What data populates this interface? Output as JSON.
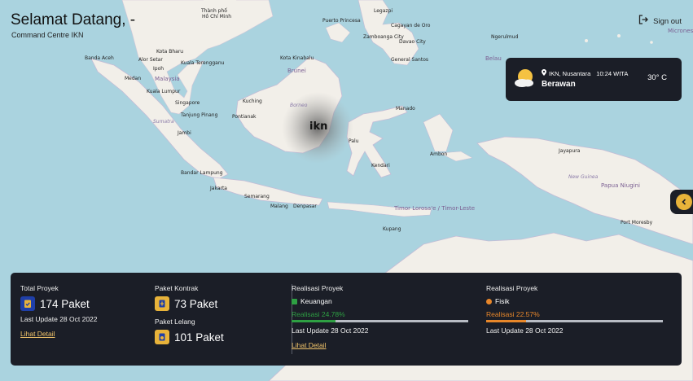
{
  "header": {
    "greeting": "Selamat Datang, -",
    "subtitle": "Command Centre IKN",
    "signout_label": "Sign out"
  },
  "weather": {
    "location": "IKN, Nusantara",
    "time": "10:24 WITA",
    "condition": "Berawan",
    "temperature": "30° C"
  },
  "map": {
    "marker_label": "ikn",
    "labels": {
      "thanh_phoho": "Thành phố",
      "hochiminh": "Hồ Chí Minh",
      "puerto": "Puerto Princesa",
      "legazpi": "Legazpi",
      "cagayan": "Cagayan de Oro",
      "zamboanga": "Zamboanga City",
      "davao": "Davao City",
      "ngerulmud": "Ngerulmud",
      "micronesia": "Micronesi",
      "banda_aceh": "Banda Aceh",
      "alor_setar": "Alor Setar",
      "kota_bharu": "Kota Bharu",
      "kuala_terengganu": "Kuala Terengganu",
      "kota_kinabalu": "Kota Kinabalu",
      "general_santos": "General Santos",
      "belau": "Belau",
      "medan": "Medan",
      "ipoh": "Ipoh",
      "malaysia": "Malaysia",
      "brunei": "Brunei",
      "kuala_lumpur": "Kuala Lumpur",
      "singapore": "Singapore",
      "kuching": "Kuching",
      "borneo": "Borneo",
      "tanjung_pinang": "Tanjung Pinang",
      "pontianak": "Pontianak",
      "sumatra": "Sumatra",
      "jambi": "Jambi",
      "manado": "Manado",
      "palu": "Palu",
      "ambon": "Ambon",
      "jayapura": "Jayapura",
      "new_guinea": "New Guinea",
      "papua_nugini": "Papua Niugini",
      "kendari": "Kendari",
      "bandar_lampung": "Bandar Lampung",
      "jakarta": "Jakarta",
      "semarang": "Semarang",
      "malang": "Malang",
      "denpasar": "Denpasar",
      "timor_leste": "Timor Lorosa'e / Timor-Leste",
      "kupang": "Kupang",
      "port_moresby": "Port Moresby"
    }
  },
  "summary": {
    "total_proyek": {
      "label": "Total Proyek",
      "value": "174 Paket",
      "updated": "Last Update 28 Oct 2022",
      "link": "Lihat Detail"
    },
    "paket_kontrak": {
      "label": "Paket Kontrak",
      "value": "73 Paket"
    },
    "paket_lelang": {
      "label": "Paket Lelang",
      "value": "101 Paket"
    },
    "realisasi_keuangan": {
      "label": "Realisasi Proyek",
      "legend": "Keuangan",
      "percent_text": "Realisasi 24.78%",
      "percent": 24.78,
      "color": "#2ea043",
      "updated": "Last Update 28 Oct 2022",
      "link": "Lihat Detail"
    },
    "realisasi_fisik": {
      "label": "Realisasi Proyek",
      "legend": "Fisik",
      "percent_text": "Realisasi 22.57%",
      "percent": 22.57,
      "color": "#e8872a",
      "updated": "Last Update 28 Oct 2022"
    }
  },
  "colors": {
    "panel": "#1b1e27",
    "accent": "#e8b33a",
    "water": "#aad3df",
    "land": "#f2efe9"
  }
}
